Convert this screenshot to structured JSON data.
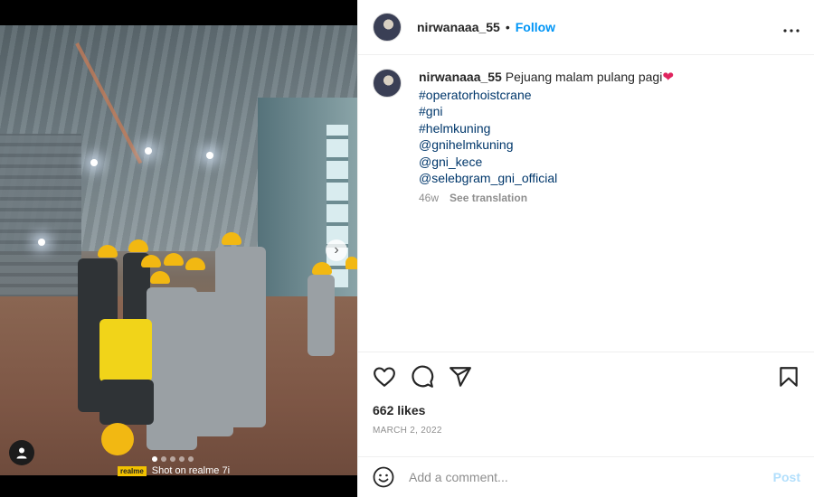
{
  "post": {
    "username": "nirwanaaa_55",
    "header_separator": "•",
    "follow_label": "Follow",
    "more_icon": "more-horizontal-icon"
  },
  "media": {
    "next_icon": "chevron-right-icon",
    "next_glyph": "›",
    "user_tag_icon": "user-tag-icon",
    "carousel_dots": 5,
    "carousel_active_index": 0,
    "watermark_brand": "realme",
    "watermark_text": "Shot on realme 7i"
  },
  "caption": {
    "username": "nirwanaaa_55",
    "text": "Pejuang malam pulang pagi",
    "emoji": "❤",
    "tags": [
      "#operatorhoistcrane",
      "#gni",
      "#helmkuning",
      "@gnihelmkuning",
      "@gni_kece",
      "@selebgram_gni_official"
    ],
    "age": "46w",
    "see_translation": "See translation"
  },
  "actions": {
    "like_icon": "heart-icon",
    "comment_icon": "comment-icon",
    "share_icon": "share-icon",
    "save_icon": "bookmark-icon"
  },
  "likes": "662 likes",
  "date": "MARCH 2, 2022",
  "comment_box": {
    "emoji_icon": "emoji-icon",
    "placeholder": "Add a comment...",
    "post_label": "Post"
  },
  "colors": {
    "follow": "#0095f6",
    "hashtag": "#00376b",
    "post_disabled": "#b2dffc",
    "helmet": "#f2b812"
  }
}
